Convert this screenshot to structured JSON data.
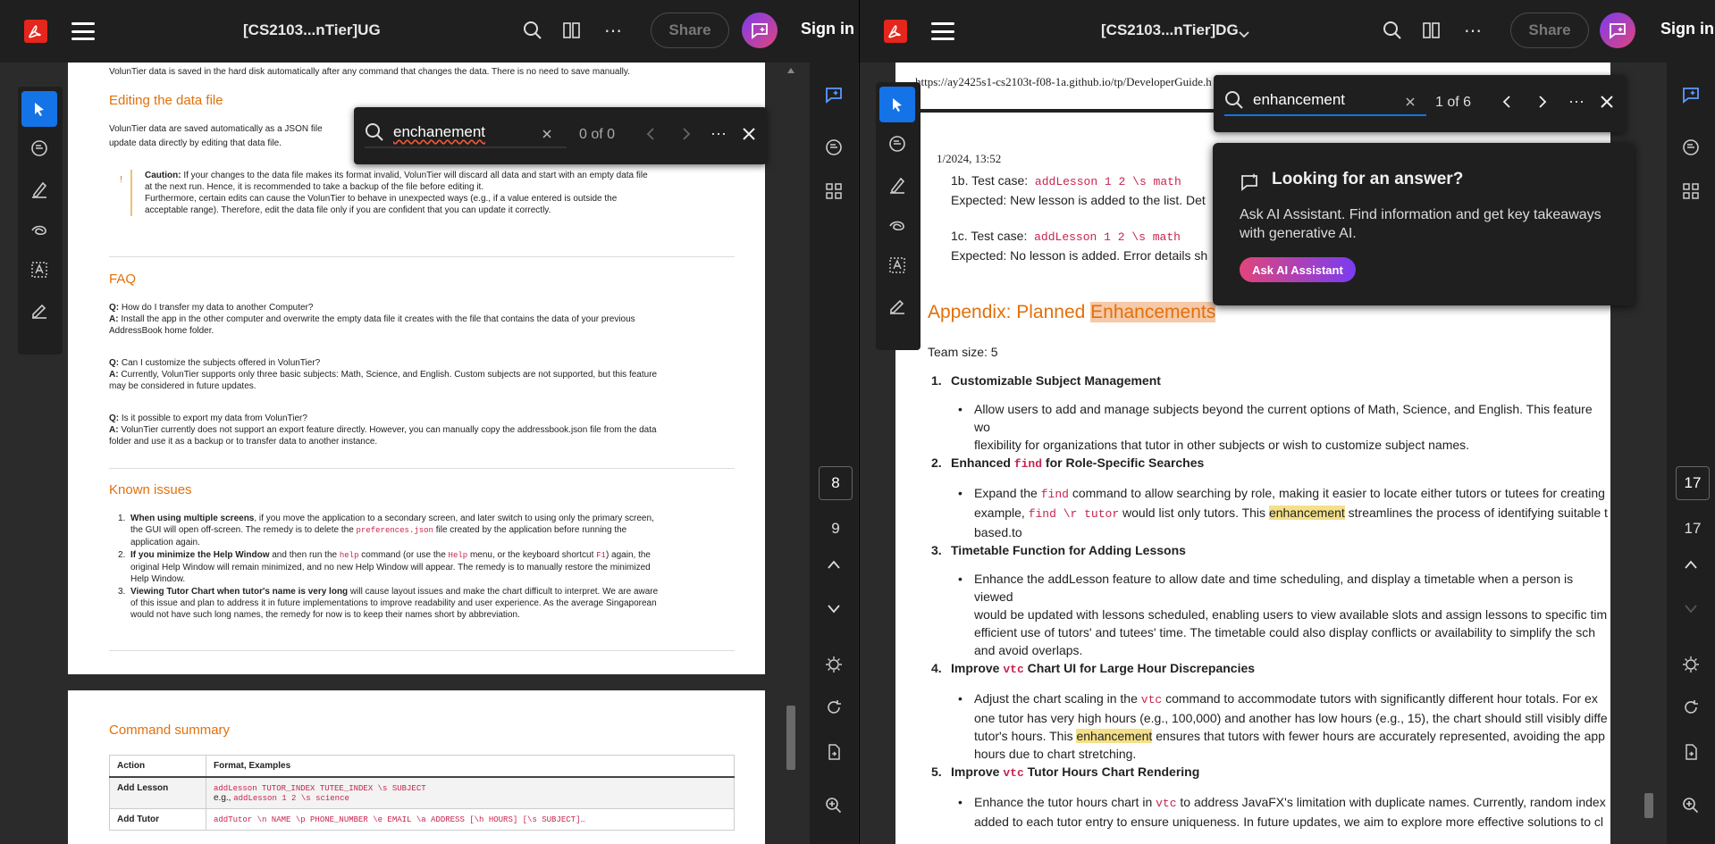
{
  "left": {
    "title": "[CS2103...nTier]UG",
    "share_label": "Share",
    "signin_label": "Sign in",
    "find": {
      "query": "enchanement",
      "count": "0 of 0"
    },
    "page_current": "8",
    "page_next": "9",
    "doc": {
      "top_line": "VolunTier data is saved in the hard disk automatically after any command that changes the data. There is no need to save manually.",
      "editing_heading": "Editing the data file",
      "editing_text_1": "VolunTier data are saved automatically as a JSON file",
      "editing_text_2": "update data directly by editing that data file.",
      "caution_label": "Caution:",
      "caution_text_1": " If your changes to the data file makes its format invalid, VolunTier will discard all data and start with an empty data file",
      "caution_text_2": "at the next run. Hence, it is recommended to take a backup of the file before editing it.",
      "caution_text_3": "Furthermore, certain edits can cause the VolunTier to behave in unexpected ways (e.g., if a value entered is outside the",
      "caution_text_4": "acceptable range). Therefore, edit the data file only if you are confident that you can update it correctly.",
      "faq_heading": "FAQ",
      "faq": [
        {
          "q": " How do I transfer my data to another Computer?",
          "a": " Install the app in the other computer and overwrite the empty data file it creates with the file that contains the data of your previous",
          "a2": "AddressBook home folder."
        },
        {
          "q": " Can I customize the subjects offered in VolunTier?",
          "a": " Currently, VolunTier supports only three basic subjects: Math, Science, and English. Custom subjects are not supported, but this feature",
          "a2": "may be considered in future updates."
        },
        {
          "q": " Is it possible to export my data from VolunTier?",
          "a": " VolunTier currently does not support an export feature directly. However, you can manually copy the addressbook.json file from the data",
          "a2": "folder and use it as a backup or to transfer data to another instance."
        }
      ],
      "q_label": "Q:",
      "a_label": "A:",
      "known_heading": "Known issues",
      "issue1_bold": "When using multiple screens",
      "issue1_a": ", if you move the application to a secondary screen, and later switch to using only the primary screen,",
      "issue1_b": "the GUI will open off-screen. The remedy is to delete the",
      "issue1_code": "preferences.json",
      "issue1_c": "file created by the application before running the",
      "issue1_d": "application again.",
      "issue2_bold": "If you minimize the Help Window",
      "issue2_a": " and then run the",
      "issue2_code1": "help",
      "issue2_b": "command (or use the",
      "issue2_code2": "Help",
      "issue2_c": "menu, or the keyboard shortcut",
      "issue2_code3": "F1",
      "issue2_d": ") again, the",
      "issue2_e": "original Help Window will remain minimized, and no new Help Window will appear. The remedy is to manually restore the minimized",
      "issue2_f": "Help Window.",
      "issue3_bold": "Viewing Tutor Chart when tutor's name is very long",
      "issue3_a": " will cause layout issues and make the chart difficult to interpret. We are aware",
      "issue3_b": "of this issue and plan to address it in future implementations to improve readability and user experience. As the average Singaporean",
      "issue3_c": "would not have such long names, the remedy for now is to keep their names short by abbreviation.",
      "cmd_heading": "Command summary",
      "table_headers": [
        "Action",
        "Format, Examples"
      ],
      "row1_action": "Add Lesson",
      "row1_fmt": "addLesson TUTOR_INDEX TUTEE_INDEX \\s SUBJECT",
      "row1_eg_label": "e.g.,",
      "row1_eg": "addLesson 1 2 \\s science",
      "row2_action": "Add Tutor",
      "row2_fmt": "addTutor \\n NAME \\p PHONE_NUMBER \\e EMAIL \\a ADDRESS [\\h HOURS] [\\s SUBJECT]…"
    }
  },
  "right": {
    "title": "[CS2103...nTier]DG",
    "share_label": "Share",
    "signin_label": "Sign in",
    "find": {
      "query": "enhancement",
      "count": "1 of 6"
    },
    "page_current": "17",
    "page_next": "17",
    "popup": {
      "title": "Looking for an answer?",
      "text": "Ask AI Assistant. Find information and get key takeaways with generative AI.",
      "button": "Ask AI Assistant"
    },
    "doc": {
      "url": "https://ay2425s1-cs2103t-f08-1a.github.io/tp/DeveloperGuide.h",
      "date": "1/2024, 13:52",
      "tc1b_label": "1b. Test case:",
      "tc1b_code": "addLesson 1 2 \\s math",
      "tc1b_expected": "Expected: New lesson is added to the list. Det",
      "tc1c_label": "1c. Test case:",
      "tc1c_code": "addLesson 1 2 \\s math",
      "tc1c_expected": "Expected: No lesson is added. Error details sh",
      "appendix_a": "Appendix: Planned ",
      "appendix_b": "Enhancements",
      "team_size": "Team size: 5",
      "item1_title": "Customizable Subject Management",
      "item1_l1": "Allow users to add and manage subjects beyond the current options of Math, Science, and English. This feature wo",
      "item1_l2": "flexibility for organizations that tutor in other subjects or wish to customize subject names.",
      "item2_a": "Enhanced",
      "item2_code": "find",
      "item2_b": "for Role-Specific Searches",
      "item2_l1a": "Expand the",
      "item2_l1code": "find",
      "item2_l1b": "command to allow searching by role, making it easier to locate either tutors or tutees for creating",
      "item2_l2a": "example,",
      "item2_l2code": "find \\r tutor",
      "item2_l2b": "would list only tutors. This",
      "item2_l2hl": "enhancement",
      "item2_l2c": "streamlines the process of identifying suitable t",
      "item2_l3": "based.to",
      "item3_title": "Timetable Function for Adding Lessons",
      "item3_l1": "Enhance the addLesson feature to allow date and time scheduling, and display a timetable when a person is viewed",
      "item3_l2": "would be updated with lessons scheduled, enabling users to view available slots and assign lessons to specific tim",
      "item3_l3": "efficient use of tutors' and tutees' time. The timetable could also display conflicts or availability to simplify the sch",
      "item3_l4": "and avoid overlaps.",
      "item4_a": "Improve",
      "item4_code": "vtc",
      "item4_b": "Chart UI for Large Hour Discrepancies",
      "item4_l1a": "Adjust the chart scaling in the",
      "item4_l1code": "vtc",
      "item4_l1b": "command to accommodate tutors with significantly different hour totals. For ex",
      "item4_l2": "one tutor has very high hours (e.g., 100,000) and another has low hours (e.g., 15), the chart should still visibly diffe",
      "item4_l3a": "tutor's hours. This",
      "item4_l3hl": "enhancement",
      "item4_l3b": "ensures that tutors with fewer hours are accurately represented, avoiding the app",
      "item4_l4": "hours due to chart stretching.",
      "item5_a": "Improve",
      "item5_code": "vtc",
      "item5_b": "Tutor Hours Chart Rendering",
      "item5_l1a": "Enhance the tutor hours chart in",
      "item5_l1code": "vtc",
      "item5_l1b": "to address JavaFX's limitation with duplicate names. Currently, random index",
      "item5_l2": "added to each tutor entry to ensure uniqueness. In future updates, we aim to explore more effective solutions to cl"
    }
  },
  "colors": {
    "accent": "#1473e6",
    "heading_orange": "#e2700b",
    "code_pink": "#c7254e",
    "highlight": "#f5e08a"
  }
}
